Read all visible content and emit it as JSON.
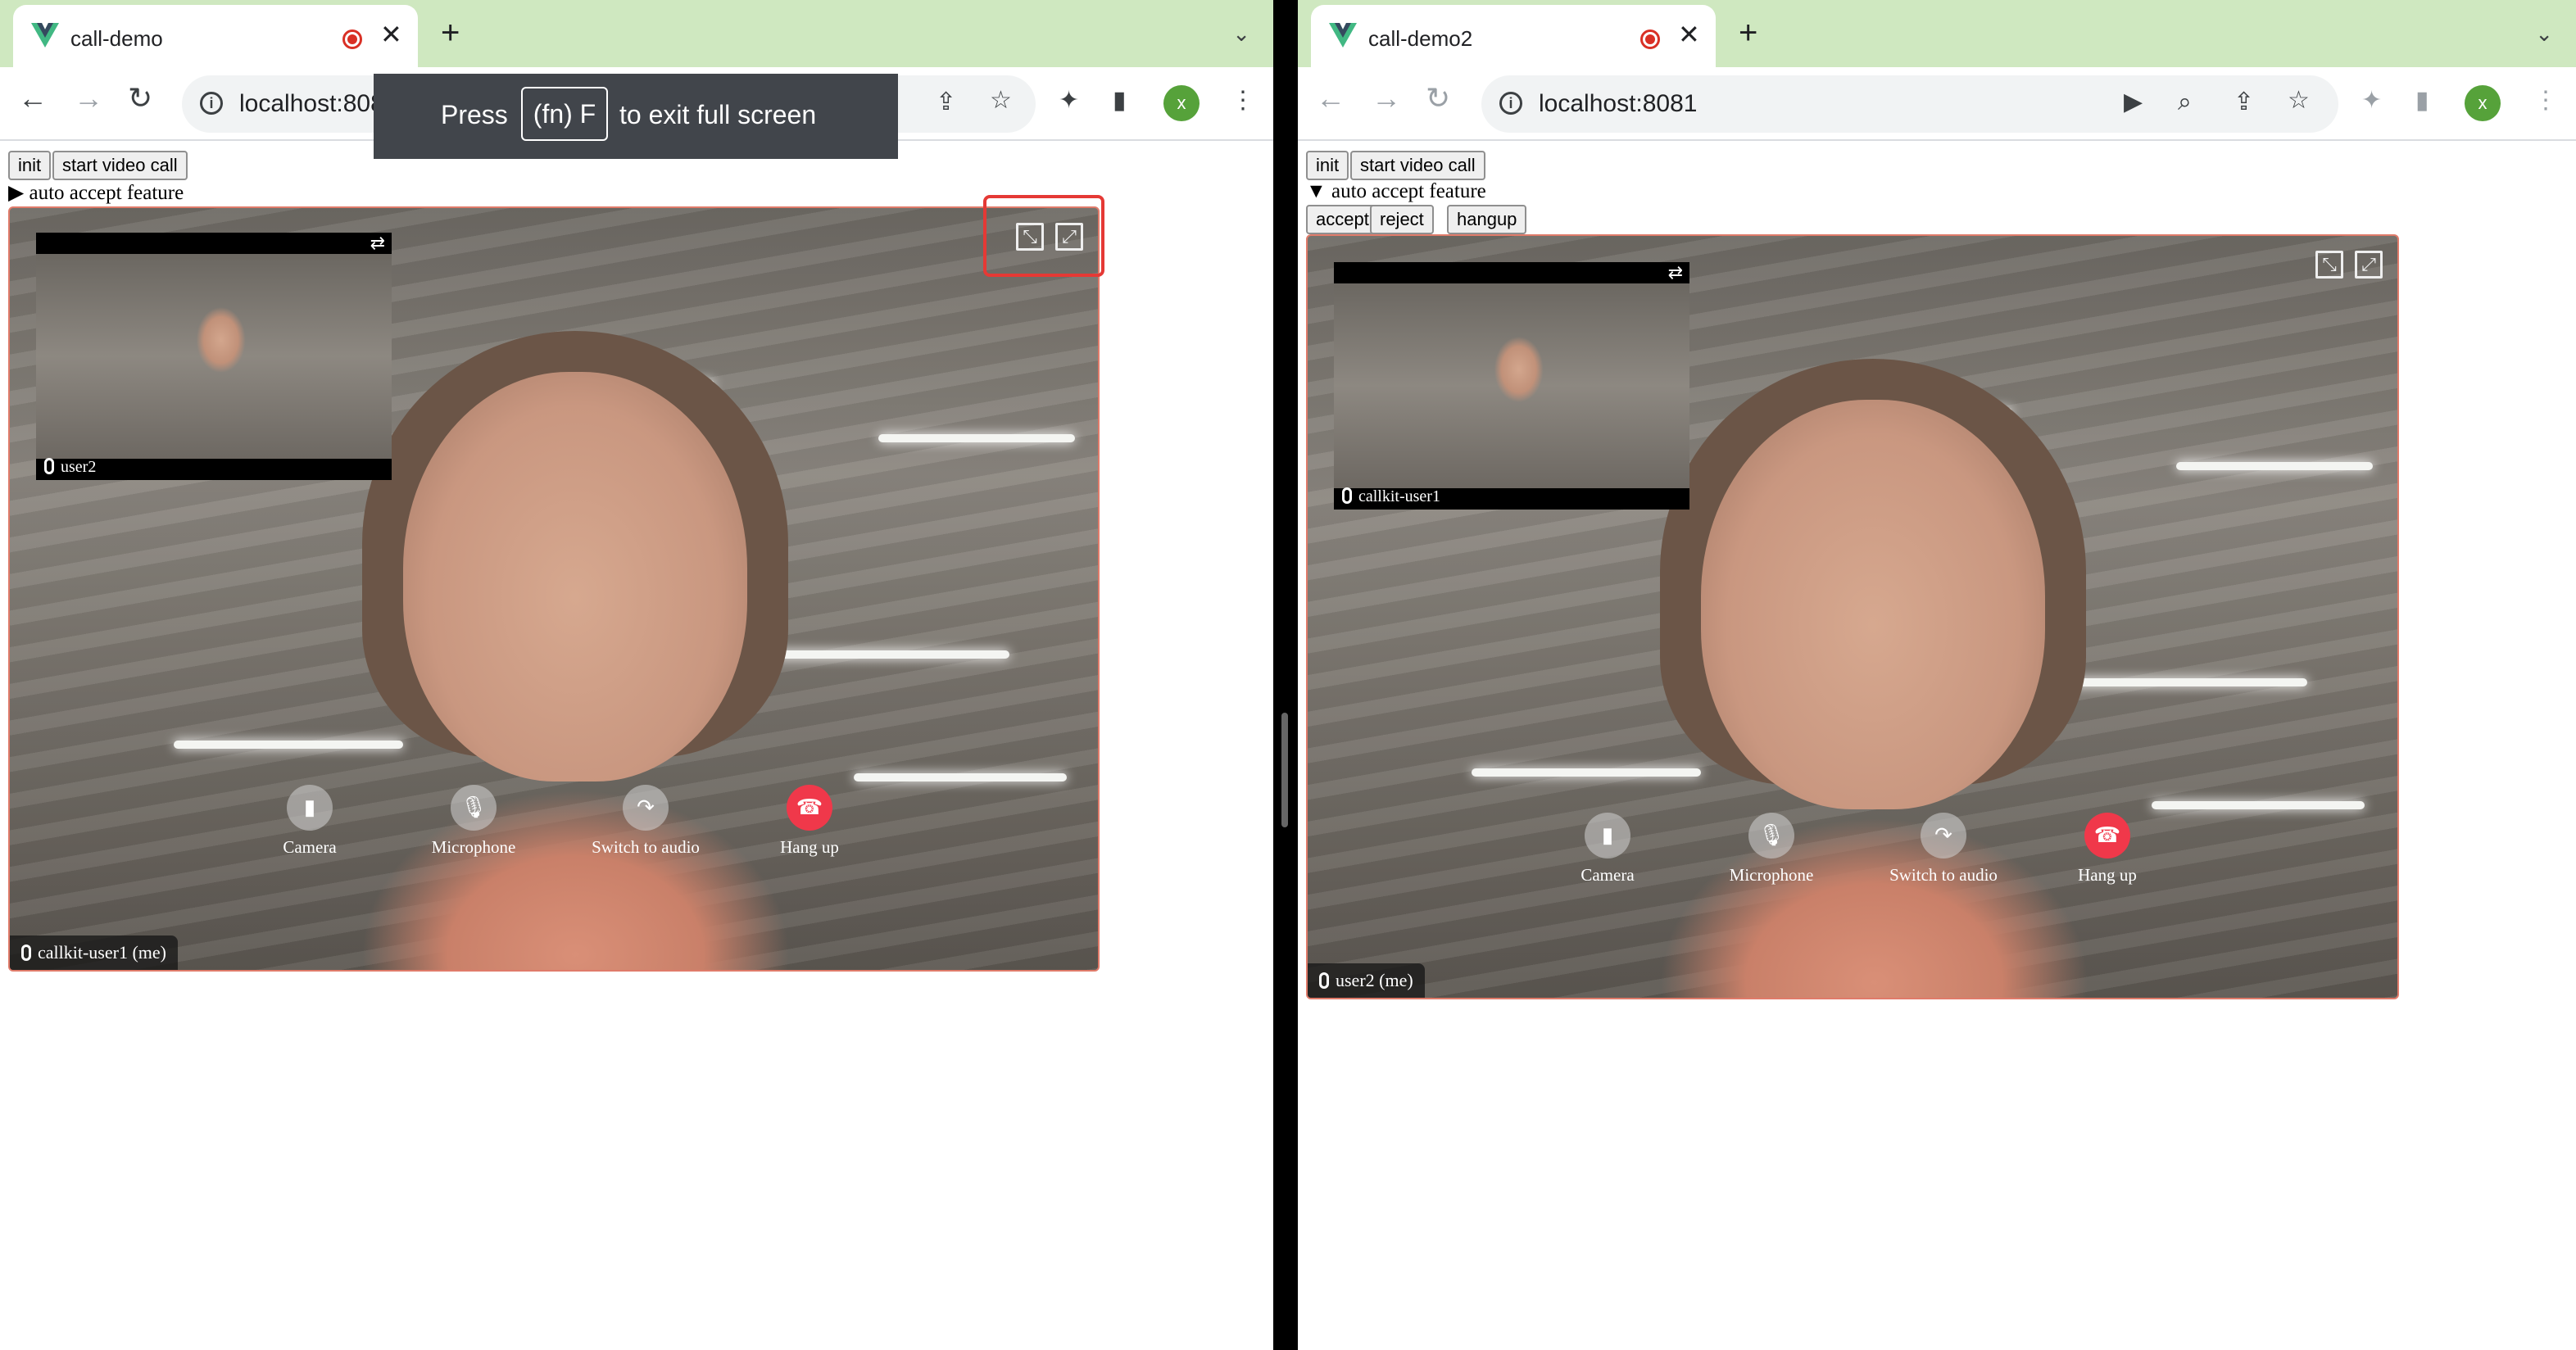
{
  "left": {
    "tab_title": "call-demo",
    "url": "localhost:8080",
    "avatar_letter": "x",
    "buttons": {
      "init": "init",
      "start": "start video call"
    },
    "summary": "▶ auto accept feature",
    "pip_name": "user2",
    "self_name": "callkit-user1 (me)",
    "controls": {
      "camera": "Camera",
      "microphone": "Microphone",
      "switch_audio": "Switch to audio",
      "hangup": "Hang up"
    },
    "toast": {
      "press": "Press",
      "key": "(fn) F",
      "rest": "to exit full screen"
    }
  },
  "right": {
    "tab_title": "call-demo2",
    "url": "localhost:8081",
    "avatar_letter": "x",
    "buttons": {
      "init": "init",
      "start": "start video call",
      "accept": "accept",
      "reject": "reject",
      "hangup": "hangup"
    },
    "summary": "▼ auto accept feature",
    "pip_name": "callkit-user1",
    "self_name": "user2 (me)",
    "controls": {
      "camera": "Camera",
      "microphone": "Microphone",
      "switch_audio": "Switch to audio",
      "hangup": "Hang up"
    }
  },
  "colors": {
    "tabstrip": "#cfe8c0",
    "hangup": "#f0384a",
    "highlight": "#e53935"
  }
}
